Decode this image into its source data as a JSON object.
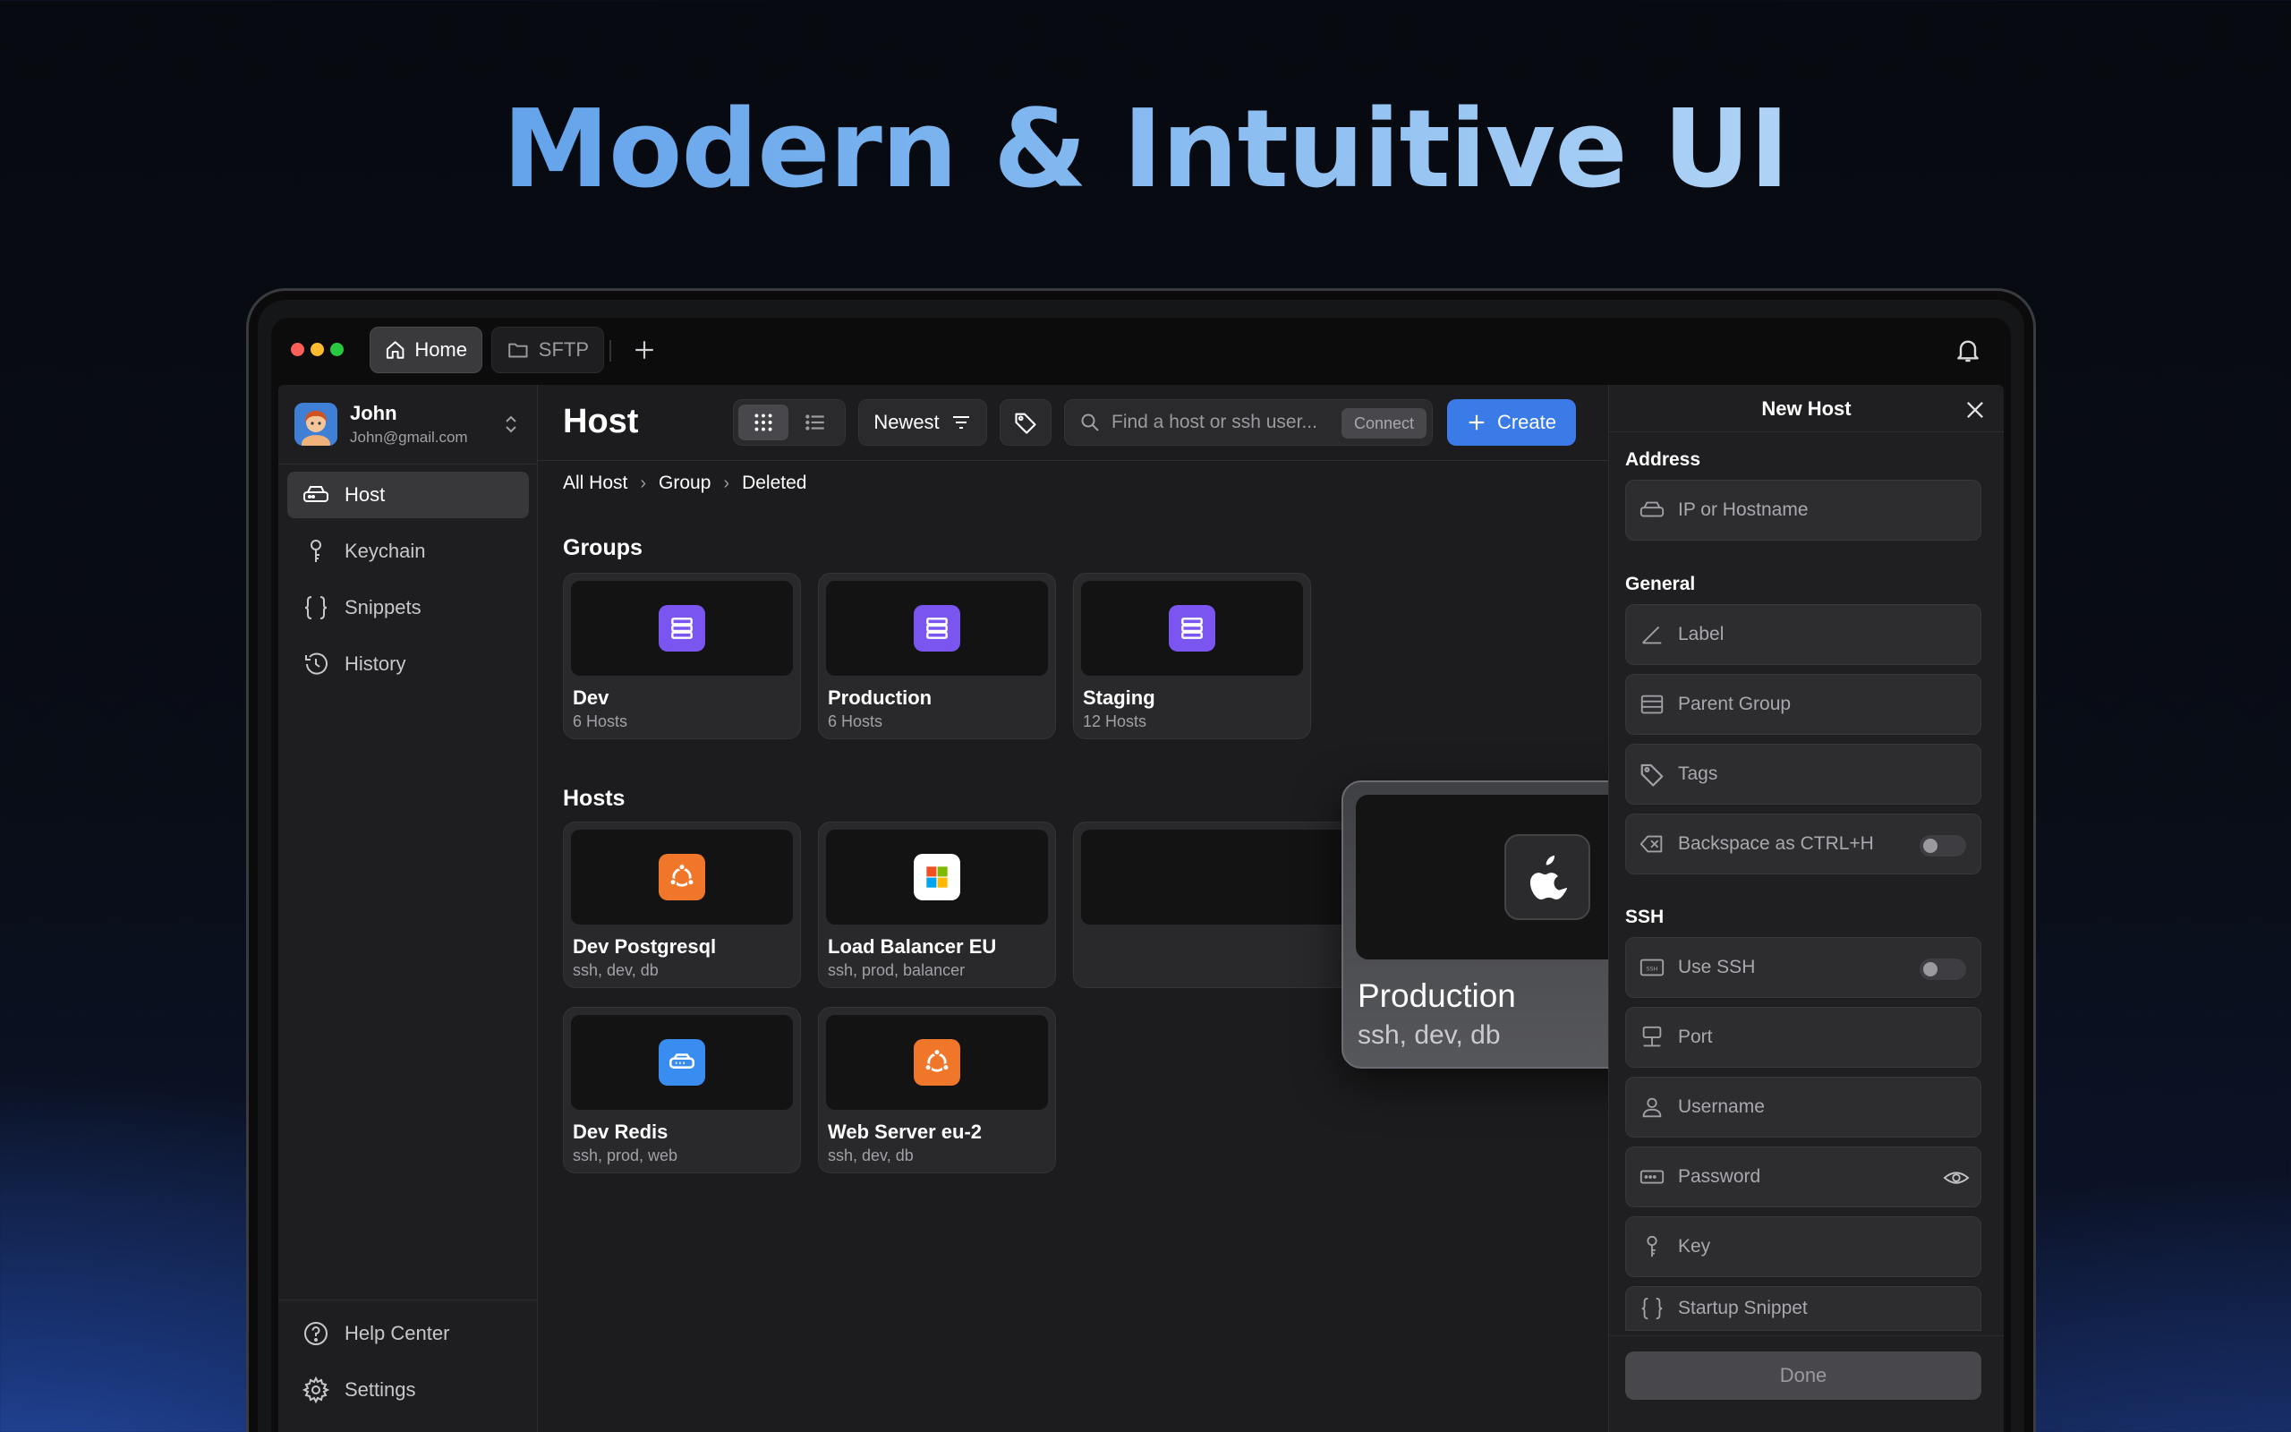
{
  "headline": "Modern & Intuitive UI",
  "tabs": [
    {
      "label": "Home",
      "icon": "home-icon",
      "active": true
    },
    {
      "label": "SFTP",
      "icon": "folder-icon",
      "active": false
    }
  ],
  "user": {
    "name": "John",
    "email": "John@gmail.com"
  },
  "sidebar": {
    "items": [
      {
        "label": "Host",
        "icon": "host-icon"
      },
      {
        "label": "Keychain",
        "icon": "key-icon"
      },
      {
        "label": "Snippets",
        "icon": "braces-icon"
      },
      {
        "label": "History",
        "icon": "history-icon"
      }
    ],
    "footer": [
      {
        "label": "Help Center",
        "icon": "help-icon"
      },
      {
        "label": "Settings",
        "icon": "gear-icon"
      }
    ]
  },
  "main": {
    "title": "Host",
    "sort_label": "Newest",
    "search_placeholder": "Find a host or ssh user...",
    "connect_label": "Connect",
    "create_label": "Create",
    "breadcrumb": [
      "All Host",
      "Group",
      "Deleted"
    ],
    "groups_title": "Groups",
    "groups": [
      {
        "name": "Dev",
        "count": "6 Hosts"
      },
      {
        "name": "Production",
        "count": "6 Hosts"
      },
      {
        "name": "Staging",
        "count": "12 Hosts"
      }
    ],
    "hosts_title": "Hosts",
    "hosts": [
      {
        "name": "Dev Postgresql",
        "tags": "ssh, dev, db",
        "icon": "ubuntu-icon"
      },
      {
        "name": "Load Balancer EU",
        "tags": "ssh, prod, balancer",
        "icon": "windows-icon"
      },
      {
        "name": "Dev Redis",
        "tags": "ssh, prod, web",
        "icon": "server-icon"
      },
      {
        "name": "Web Server eu-2",
        "tags": "ssh, dev, db",
        "icon": "ubuntu-icon"
      }
    ],
    "dragged_host": {
      "name": "Production",
      "tags": "ssh, dev, db",
      "icon": "apple-icon"
    }
  },
  "panel": {
    "title": "New Host",
    "address_label": "Address",
    "address_placeholder": "IP or Hostname",
    "general_label": "General",
    "general_fields": [
      "Label",
      "Parent Group",
      "Tags",
      "Backspace as CTRL+H"
    ],
    "ssh_label": "SSH",
    "ssh_fields": [
      "Use SSH",
      "Port",
      "Username",
      "Password",
      "Key",
      "Startup Snippet"
    ],
    "done_label": "Done"
  },
  "colors": {
    "accent": "#3a7be8",
    "group_icon": "#7b55f0",
    "ubuntu": "#f0762a",
    "redis_icon": "#3a8df0"
  }
}
